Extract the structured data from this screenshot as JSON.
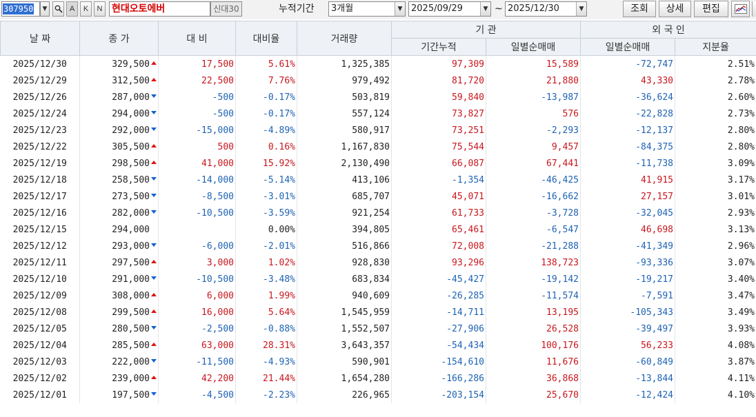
{
  "toolbar": {
    "code": "307950",
    "buttons": [
      "A",
      "K",
      "N"
    ],
    "stock_name": "현대오토에버",
    "new_label": "신대30",
    "period_label": "누적기간",
    "period_value": "3개월",
    "date_from": "2025/09/29",
    "tilde": "~",
    "date_to": "2025/12/30",
    "query_btn": "조회",
    "detail_btn": "상세",
    "edit_btn": "편집"
  },
  "header": {
    "date": "날 짜",
    "close": "종 가",
    "change": "대 비",
    "rate": "대비율",
    "volume": "거래량",
    "institution": "기 관",
    "inst_cum": "기간누적",
    "inst_daily": "일별순매매",
    "foreign": "외 국 인",
    "for_daily": "일별순매매",
    "share": "지분율"
  },
  "colors": {
    "up": "#c8161d",
    "down": "#1d62b4",
    "header_bg": "#eef1f5"
  },
  "rows": [
    {
      "date": "2025/12/30",
      "close": "329,500",
      "dir": "up",
      "change": "17,500",
      "rate": "5.61%",
      "volume": "1,325,385",
      "inst_cum": "97,309",
      "inst_daily": "15,589",
      "for_daily": "-72,747",
      "share": "2.51%"
    },
    {
      "date": "2025/12/29",
      "close": "312,500",
      "dir": "up",
      "change": "22,500",
      "rate": "7.76%",
      "volume": "979,492",
      "inst_cum": "81,720",
      "inst_daily": "21,880",
      "for_daily": "43,330",
      "share": "2.78%"
    },
    {
      "date": "2025/12/26",
      "close": "287,000",
      "dir": "down",
      "change": "-500",
      "rate": "-0.17%",
      "volume": "503,819",
      "inst_cum": "59,840",
      "inst_daily": "-13,987",
      "for_daily": "-36,624",
      "share": "2.60%"
    },
    {
      "date": "2025/12/24",
      "close": "294,000",
      "dir": "down",
      "change": "-500",
      "rate": "-0.17%",
      "volume": "557,124",
      "inst_cum": "73,827",
      "inst_daily": "576",
      "for_daily": "-22,828",
      "share": "2.73%"
    },
    {
      "date": "2025/12/23",
      "close": "292,000",
      "dir": "down",
      "change": "-15,000",
      "rate": "-4.89%",
      "volume": "580,917",
      "inst_cum": "73,251",
      "inst_daily": "-2,293",
      "for_daily": "-12,137",
      "share": "2.80%"
    },
    {
      "date": "2025/12/22",
      "close": "305,500",
      "dir": "up",
      "change": "500",
      "rate": "0.16%",
      "volume": "1,167,830",
      "inst_cum": "75,544",
      "inst_daily": "9,457",
      "for_daily": "-84,375",
      "share": "2.80%"
    },
    {
      "date": "2025/12/19",
      "close": "298,500",
      "dir": "up",
      "change": "41,000",
      "rate": "15.92%",
      "volume": "2,130,490",
      "inst_cum": "66,087",
      "inst_daily": "67,441",
      "for_daily": "-11,738",
      "share": "3.09%"
    },
    {
      "date": "2025/12/18",
      "close": "258,500",
      "dir": "down",
      "change": "-14,000",
      "rate": "-5.14%",
      "volume": "413,106",
      "inst_cum": "-1,354",
      "inst_daily": "-46,425",
      "for_daily": "41,915",
      "share": "3.17%"
    },
    {
      "date": "2025/12/17",
      "close": "273,500",
      "dir": "down",
      "change": "-8,500",
      "rate": "-3.01%",
      "volume": "685,707",
      "inst_cum": "45,071",
      "inst_daily": "-16,662",
      "for_daily": "27,157",
      "share": "3.01%"
    },
    {
      "date": "2025/12/16",
      "close": "282,000",
      "dir": "down",
      "change": "-10,500",
      "rate": "-3.59%",
      "volume": "921,254",
      "inst_cum": "61,733",
      "inst_daily": "-3,728",
      "for_daily": "-32,045",
      "share": "2.93%"
    },
    {
      "date": "2025/12/15",
      "close": "294,000",
      "dir": "flat",
      "change": "",
      "rate": "0.00%",
      "volume": "394,805",
      "inst_cum": "65,461",
      "inst_daily": "-6,547",
      "for_daily": "46,698",
      "share": "3.13%"
    },
    {
      "date": "2025/12/12",
      "close": "293,000",
      "dir": "down",
      "change": "-6,000",
      "rate": "-2.01%",
      "volume": "516,866",
      "inst_cum": "72,008",
      "inst_daily": "-21,288",
      "for_daily": "-41,349",
      "share": "2.96%"
    },
    {
      "date": "2025/12/11",
      "close": "297,500",
      "dir": "up",
      "change": "3,000",
      "rate": "1.02%",
      "volume": "928,830",
      "inst_cum": "93,296",
      "inst_daily": "138,723",
      "for_daily": "-93,336",
      "share": "3.07%"
    },
    {
      "date": "2025/12/10",
      "close": "291,000",
      "dir": "down",
      "change": "-10,500",
      "rate": "-3.48%",
      "volume": "683,834",
      "inst_cum": "-45,427",
      "inst_daily": "-19,142",
      "for_daily": "-19,217",
      "share": "3.40%"
    },
    {
      "date": "2025/12/09",
      "close": "308,000",
      "dir": "up",
      "change": "6,000",
      "rate": "1.99%",
      "volume": "940,609",
      "inst_cum": "-26,285",
      "inst_daily": "-11,574",
      "for_daily": "-7,591",
      "share": "3.47%"
    },
    {
      "date": "2025/12/08",
      "close": "299,500",
      "dir": "up",
      "change": "16,000",
      "rate": "5.64%",
      "volume": "1,545,959",
      "inst_cum": "-14,711",
      "inst_daily": "13,195",
      "for_daily": "-105,343",
      "share": "3.49%"
    },
    {
      "date": "2025/12/05",
      "close": "280,500",
      "dir": "down",
      "change": "-2,500",
      "rate": "-0.88%",
      "volume": "1,552,507",
      "inst_cum": "-27,906",
      "inst_daily": "26,528",
      "for_daily": "-39,497",
      "share": "3.93%"
    },
    {
      "date": "2025/12/04",
      "close": "285,500",
      "dir": "up",
      "change": "63,000",
      "rate": "28.31%",
      "volume": "3,643,357",
      "inst_cum": "-54,434",
      "inst_daily": "100,176",
      "for_daily": "56,233",
      "share": "4.08%"
    },
    {
      "date": "2025/12/03",
      "close": "222,000",
      "dir": "down",
      "change": "-11,500",
      "rate": "-4.93%",
      "volume": "590,901",
      "inst_cum": "-154,610",
      "inst_daily": "11,676",
      "for_daily": "-60,849",
      "share": "3.87%"
    },
    {
      "date": "2025/12/02",
      "close": "239,000",
      "dir": "up",
      "change": "42,200",
      "rate": "21.44%",
      "volume": "1,654,280",
      "inst_cum": "-166,286",
      "inst_daily": "36,868",
      "for_daily": "-13,844",
      "share": "4.11%"
    },
    {
      "date": "2025/12/01",
      "close": "197,500",
      "dir": "down",
      "change": "-4,500",
      "rate": "-2.23%",
      "volume": "226,965",
      "inst_cum": "-203,154",
      "inst_daily": "25,670",
      "for_daily": "-12,424",
      "share": "4.10%"
    }
  ]
}
